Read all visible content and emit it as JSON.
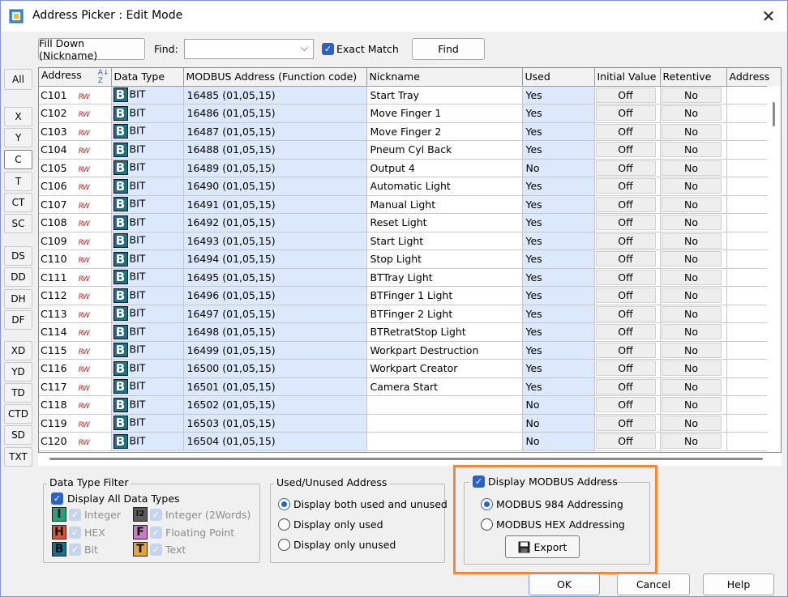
{
  "window": {
    "title": "Address Picker : Edit Mode",
    "close_glyph": "✕"
  },
  "toolbar": {
    "fill_down_label": "Fill Down (Nickname)",
    "find_label": "Find:",
    "find_value": "",
    "exact_match_label": "Exact Match",
    "find_button": "Find"
  },
  "sidebar": [
    "All",
    "X",
    "Y",
    "C",
    "T",
    "CT",
    "SC",
    "DS",
    "DD",
    "DH",
    "DF",
    "XD",
    "YD",
    "TD",
    "CTD",
    "SD",
    "TXT"
  ],
  "sidebar_selected": "C",
  "table": {
    "headers": [
      "Address",
      "Data Type",
      "MODBUS Address (Function code)",
      "Nickname",
      "Used",
      "Initial Value",
      "Retentive",
      "Address"
    ],
    "rw_label": "RW",
    "type_letter": "B",
    "rows": [
      {
        "address": "C101",
        "type": "BIT",
        "modbus": "16485 (01,05,15)",
        "nickname": "Start Tray",
        "used": "Yes",
        "initial": "Off",
        "retentive": "No"
      },
      {
        "address": "C102",
        "type": "BIT",
        "modbus": "16486 (01,05,15)",
        "nickname": "Move Finger 1",
        "used": "Yes",
        "initial": "Off",
        "retentive": "No"
      },
      {
        "address": "C103",
        "type": "BIT",
        "modbus": "16487 (01,05,15)",
        "nickname": "Move Finger 2",
        "used": "Yes",
        "initial": "Off",
        "retentive": "No"
      },
      {
        "address": "C104",
        "type": "BIT",
        "modbus": "16488 (01,05,15)",
        "nickname": "Pneum Cyl Back",
        "used": "Yes",
        "initial": "Off",
        "retentive": "No"
      },
      {
        "address": "C105",
        "type": "BIT",
        "modbus": "16489 (01,05,15)",
        "nickname": "Output 4",
        "used": "No",
        "initial": "Off",
        "retentive": "No"
      },
      {
        "address": "C106",
        "type": "BIT",
        "modbus": "16490 (01,05,15)",
        "nickname": "Automatic Light",
        "used": "Yes",
        "initial": "Off",
        "retentive": "No"
      },
      {
        "address": "C107",
        "type": "BIT",
        "modbus": "16491 (01,05,15)",
        "nickname": "Manual Light",
        "used": "Yes",
        "initial": "Off",
        "retentive": "No"
      },
      {
        "address": "C108",
        "type": "BIT",
        "modbus": "16492 (01,05,15)",
        "nickname": "Reset Light",
        "used": "Yes",
        "initial": "Off",
        "retentive": "No"
      },
      {
        "address": "C109",
        "type": "BIT",
        "modbus": "16493 (01,05,15)",
        "nickname": "Start Light",
        "used": "Yes",
        "initial": "Off",
        "retentive": "No"
      },
      {
        "address": "C110",
        "type": "BIT",
        "modbus": "16494 (01,05,15)",
        "nickname": "Stop Light",
        "used": "Yes",
        "initial": "Off",
        "retentive": "No"
      },
      {
        "address": "C111",
        "type": "BIT",
        "modbus": "16495 (01,05,15)",
        "nickname": "BTTray Light",
        "used": "Yes",
        "initial": "Off",
        "retentive": "No"
      },
      {
        "address": "C112",
        "type": "BIT",
        "modbus": "16496 (01,05,15)",
        "nickname": "BTFinger 1 Light",
        "used": "Yes",
        "initial": "Off",
        "retentive": "No"
      },
      {
        "address": "C113",
        "type": "BIT",
        "modbus": "16497 (01,05,15)",
        "nickname": "BTFinger 2 Light",
        "used": "Yes",
        "initial": "Off",
        "retentive": "No"
      },
      {
        "address": "C114",
        "type": "BIT",
        "modbus": "16498 (01,05,15)",
        "nickname": "BTRetratStop Light",
        "used": "Yes",
        "initial": "Off",
        "retentive": "No"
      },
      {
        "address": "C115",
        "type": "BIT",
        "modbus": "16499 (01,05,15)",
        "nickname": "Workpart Destruction",
        "used": "Yes",
        "initial": "Off",
        "retentive": "No"
      },
      {
        "address": "C116",
        "type": "BIT",
        "modbus": "16500 (01,05,15)",
        "nickname": "Workpart Creator",
        "used": "Yes",
        "initial": "Off",
        "retentive": "No"
      },
      {
        "address": "C117",
        "type": "BIT",
        "modbus": "16501 (01,05,15)",
        "nickname": "Camera Start",
        "used": "Yes",
        "initial": "Off",
        "retentive": "No"
      },
      {
        "address": "C118",
        "type": "BIT",
        "modbus": "16502 (01,05,15)",
        "nickname": "",
        "used": "No",
        "initial": "Off",
        "retentive": "No"
      },
      {
        "address": "C119",
        "type": "BIT",
        "modbus": "16503 (01,05,15)",
        "nickname": "",
        "used": "No",
        "initial": "Off",
        "retentive": "No"
      },
      {
        "address": "C120",
        "type": "BIT",
        "modbus": "16504 (01,05,15)",
        "nickname": "",
        "used": "No",
        "initial": "Off",
        "retentive": "No"
      }
    ]
  },
  "data_type_filter": {
    "title": "Data Type Filter",
    "all_label": "Display All Data Types",
    "types": [
      {
        "letter": "I",
        "label": "Integer",
        "color": "#2f9d7c"
      },
      {
        "letter": "I2",
        "label": "Integer (2Words)",
        "color": "#5b5b5b"
      },
      {
        "letter": "H",
        "label": "HEX",
        "color": "#d9543a"
      },
      {
        "letter": "F",
        "label": "Floating Point",
        "color": "#c77fbf"
      },
      {
        "letter": "B",
        "label": "Bit",
        "color": "#1f6f86"
      },
      {
        "letter": "T",
        "label": "Text",
        "color": "#e0a640"
      }
    ]
  },
  "used_unused": {
    "title": "Used/Unused Address",
    "options": [
      "Display both used and unused",
      "Display only used",
      "Display only unused"
    ]
  },
  "modbus": {
    "title": "Display MODBUS Address",
    "options": [
      "MODBUS 984 Addressing",
      "MODBUS HEX Addressing"
    ],
    "export_label": "Export"
  },
  "footer": {
    "ok": "OK",
    "cancel": "Cancel",
    "help": "Help"
  },
  "colors": {
    "accent": "#2a62c9",
    "highlight": "#f08a3a",
    "blue_col": "#dce8fb"
  }
}
